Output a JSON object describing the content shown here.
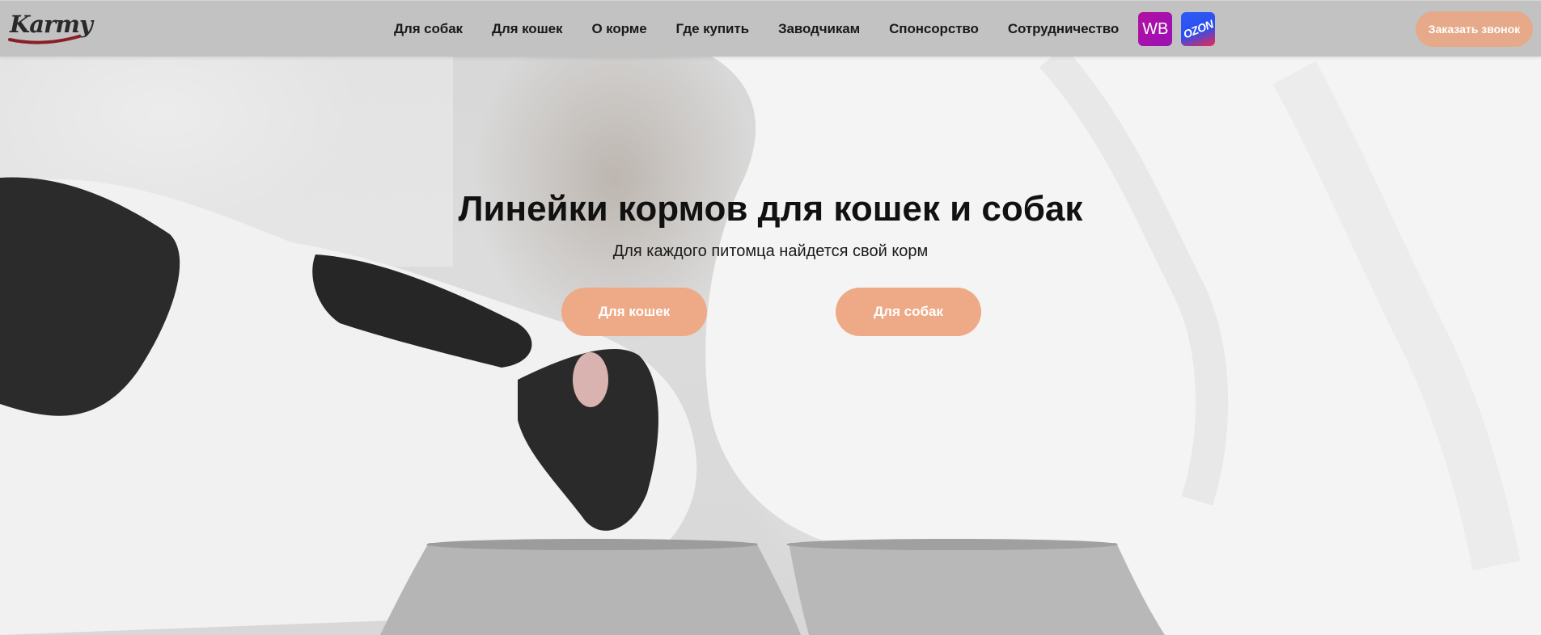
{
  "header": {
    "logo_text": "Karmy",
    "nav": [
      {
        "label": "Для собак"
      },
      {
        "label": "Для кошек"
      },
      {
        "label": "О корме"
      },
      {
        "label": "Где купить"
      },
      {
        "label": "Заводчикам"
      },
      {
        "label": "Спонсорство"
      },
      {
        "label": "Сотрудничество"
      }
    ],
    "marketplaces": {
      "wildberries": "WB",
      "ozon": "OZON"
    },
    "call_button": "Заказать звонок"
  },
  "hero": {
    "title": "Линейки кормов для кошек и собак",
    "subtitle": "Для каждого питомца найдется свой корм",
    "cta_cats": "Для кошек",
    "cta_dogs": "Для собак",
    "image_icon": "cat-and-dog-eating-photo"
  },
  "colors": {
    "accent": "#eeaa86",
    "header_bg": "#c2c2c2",
    "wb": "#a912ad",
    "ozon_blue": "#2f5cf5",
    "ozon_pink": "#f2274f"
  }
}
